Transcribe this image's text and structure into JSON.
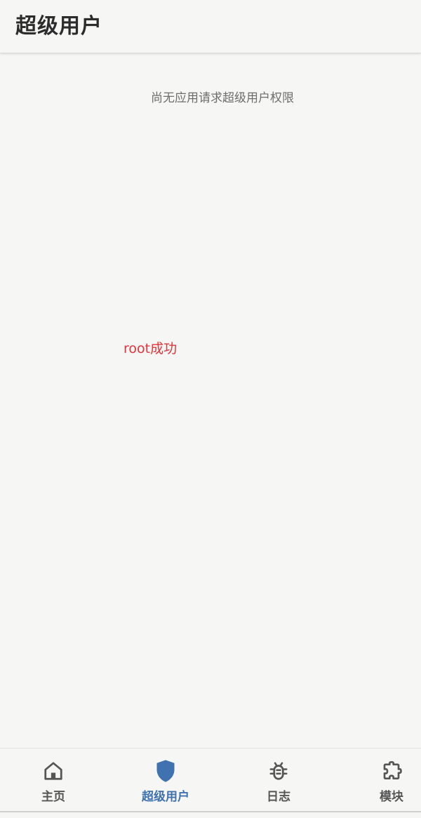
{
  "header": {
    "title": "超级用户"
  },
  "main": {
    "empty_message": "尚无应用请求超级用户权限",
    "toast": "root成功"
  },
  "bottom_nav": {
    "items": [
      {
        "label": "主页",
        "icon": "home-icon",
        "active": false
      },
      {
        "label": "超级用户",
        "icon": "shield-icon",
        "active": true
      },
      {
        "label": "日志",
        "icon": "bug-icon",
        "active": false
      },
      {
        "label": "模块",
        "icon": "puzzle-icon",
        "active": false
      }
    ]
  },
  "colors": {
    "accent": "#3f72ae",
    "toast": "#e2333a",
    "inactive": "#555555",
    "background": "#f6f7f5"
  }
}
